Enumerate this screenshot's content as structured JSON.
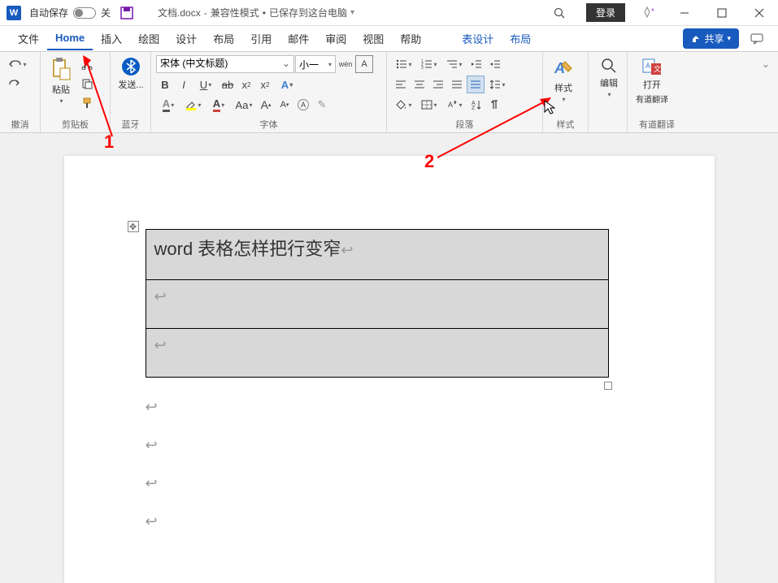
{
  "titlebar": {
    "app_letter": "W",
    "autosave_label": "自动保存",
    "autosave_state": "关",
    "doc_name": "文档.docx",
    "compat_mode": "兼容性模式",
    "saved_status": "已保存到这台电脑",
    "login_label": "登录"
  },
  "menu": {
    "items": [
      "文件",
      "Home",
      "插入",
      "绘图",
      "设计",
      "布局",
      "引用",
      "邮件",
      "审阅",
      "视图",
      "帮助"
    ],
    "context_items": [
      "表设计",
      "布局"
    ],
    "share_label": "共享"
  },
  "ribbon": {
    "undo_group": "撤消",
    "clipboard": {
      "paste": "粘贴",
      "label": "剪贴板"
    },
    "bluetooth": {
      "send": "发送...",
      "label": "蓝牙"
    },
    "font": {
      "label": "字体",
      "family": "宋体 (中文标题)",
      "size": "小一",
      "wen": "wén",
      "bold": "B",
      "italic": "I",
      "underline": "U",
      "strike": "ab",
      "sub": "x₂",
      "sup": "x²",
      "Aa": "Aa"
    },
    "paragraph": {
      "label": "段落"
    },
    "styles": {
      "label": "样式",
      "btn": "样式"
    },
    "editing": {
      "label": "编辑"
    },
    "youdao": {
      "open": "打开",
      "translate": "有道翻译",
      "label": "有道翻译"
    }
  },
  "document": {
    "table_row1": "word 表格怎样把行变窄"
  },
  "annotations": {
    "label1": "1",
    "label2": "2"
  }
}
